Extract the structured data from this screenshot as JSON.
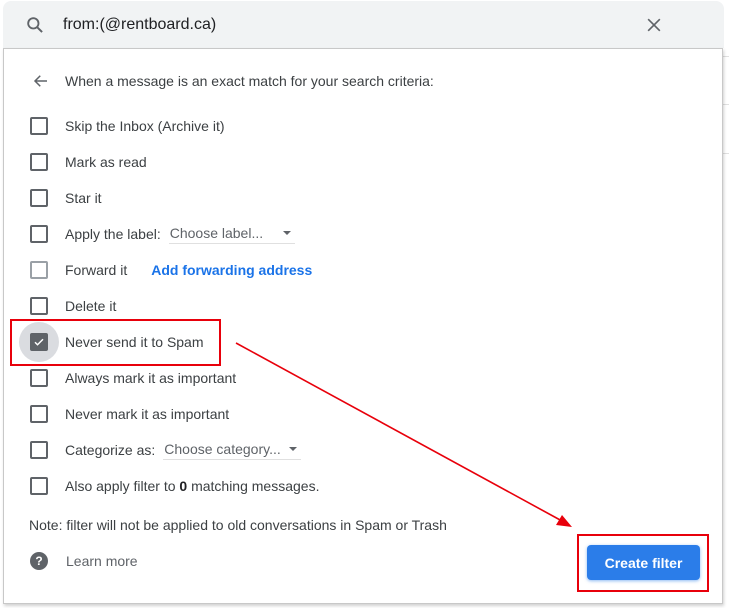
{
  "search": {
    "query": "from:(@rentboard.ca)",
    "search_icon": "search-icon",
    "clear_icon": "close-icon"
  },
  "filter_panel": {
    "header": "When a message is an exact match for your search criteria:",
    "back_icon": "arrow-left-icon",
    "options": [
      {
        "label": "Skip the Inbox (Archive it)",
        "checked": false
      },
      {
        "label": "Mark as read",
        "checked": false
      },
      {
        "label": "Star it",
        "checked": false
      },
      {
        "label": "Apply the label:",
        "checked": false,
        "select_value": "Choose label..."
      },
      {
        "label": "Forward it",
        "checked": false,
        "link": "Add forwarding address"
      },
      {
        "label": "Delete it",
        "checked": false
      },
      {
        "label": "Never send it to Spam",
        "checked": true
      },
      {
        "label": "Always mark it as important",
        "checked": false
      },
      {
        "label": "Never mark it as important",
        "checked": false
      },
      {
        "label": "Categorize as:",
        "checked": false,
        "select_value": "Choose category..."
      },
      {
        "label_prefix": "Also apply filter to ",
        "count": "0",
        "label_suffix": " matching messages.",
        "checked": false
      }
    ],
    "note": "Note: filter will not be applied to old conversations in Spam or Trash",
    "learn_more": "Learn more",
    "help_icon_glyph": "?",
    "create_button": "Create filter"
  },
  "colors": {
    "accent": "#1a73e8",
    "button": "#2b7de9",
    "annotation": "#e8000b"
  }
}
